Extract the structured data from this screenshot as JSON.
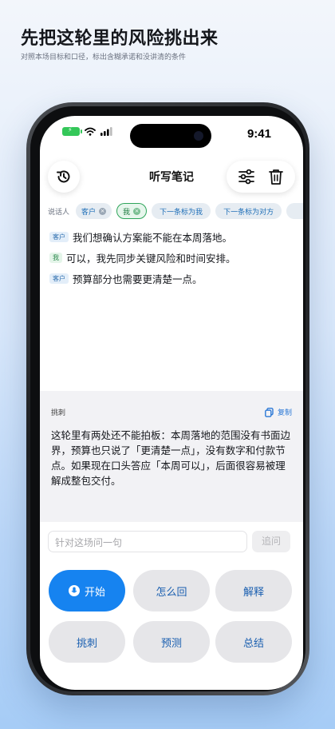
{
  "marketing": {
    "headline": "先把这轮里的风险挑出来",
    "subline": "对照本场目标和口径，标出含糊承诺和没讲清的条件"
  },
  "status_bar": {
    "time": "9:41"
  },
  "header": {
    "title": "听写笔记"
  },
  "speakers": {
    "label": "说话人",
    "chips": [
      {
        "label": "客户",
        "selected": false
      },
      {
        "label": "我",
        "selected": true
      }
    ],
    "actions": [
      "下一条标为我",
      "下一条标为对方"
    ]
  },
  "transcript": [
    {
      "speaker": "客户",
      "text": "我们想确认方案能不能在本周落地。"
    },
    {
      "speaker": "我",
      "text": "可以，我先同步关键风险和时间安排。"
    },
    {
      "speaker": "客户",
      "text": "预算部分也需要更清楚一点。"
    }
  ],
  "analysis": {
    "title": "挑刺",
    "copy_label": "复制",
    "body": "这轮里有两处还不能拍板：本周落地的范围没有书面边界，预算也只说了「更清楚一点」，没有数字和付款节点。如果现在口头答应「本周可以」，后面很容易被理解成整包交付。"
  },
  "followup": {
    "placeholder": "针对这场问一句",
    "button_label": "追问"
  },
  "actions": {
    "start": "开始",
    "reply": "怎么回",
    "explain": "解释",
    "critique": "挑刺",
    "predict": "预测",
    "summary": "总结"
  },
  "colors": {
    "accent": "#1683f0",
    "selected_chip": "#2fa55b",
    "link": "#2b78d6"
  },
  "icons": [
    "history-icon",
    "filter-sliders-icon",
    "trash-icon",
    "copy-icon",
    "mic-icon",
    "battery-icon",
    "wifi-icon",
    "signal-icon"
  ]
}
